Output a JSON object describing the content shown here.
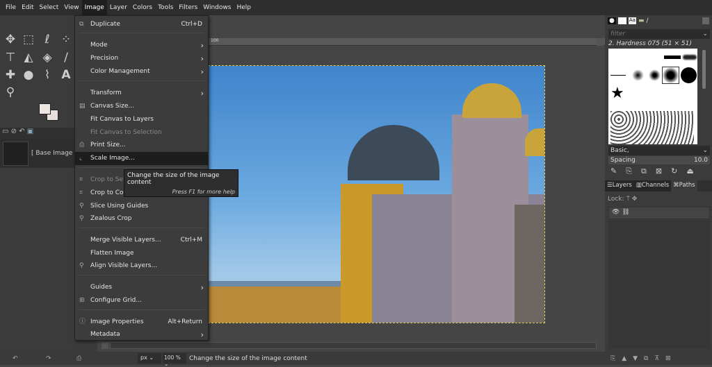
{
  "menubar": [
    "File",
    "Edit",
    "Select",
    "View",
    "Image",
    "Layer",
    "Colors",
    "Tools",
    "Filters",
    "Windows",
    "Help"
  ],
  "image_menu": {
    "items": [
      {
        "label": "Duplicate",
        "shortcut": "Ctrl+D",
        "icon": "duplicate-icon"
      },
      {
        "label": "Mode",
        "submenu": true
      },
      {
        "label": "Precision",
        "submenu": true
      },
      {
        "label": "Color Management",
        "submenu": true
      },
      {
        "label": "Transform",
        "submenu": true
      },
      {
        "label": "Canvas Size...",
        "icon": "canvas-size-icon"
      },
      {
        "label": "Fit Canvas to Layers"
      },
      {
        "label": "Fit Canvas to Selection",
        "disabled": true
      },
      {
        "label": "Print Size...",
        "icon": "printer-icon"
      },
      {
        "label": "Scale Image...",
        "icon": "scale-icon",
        "selected": true
      },
      {
        "label": "Crop to Selection",
        "disabled": true,
        "icon": "crop-icon"
      },
      {
        "label": "Crop to Content",
        "icon": "crop-icon"
      },
      {
        "label": "Slice Using Guides",
        "icon": "slice-icon"
      },
      {
        "label": "Zealous Crop",
        "icon": "zealous-crop-icon"
      },
      {
        "label": "Merge Visible Layers...",
        "shortcut": "Ctrl+M"
      },
      {
        "label": "Flatten Image"
      },
      {
        "label": "Align Visible Layers...",
        "icon": "align-icon"
      },
      {
        "label": "Guides",
        "submenu": true
      },
      {
        "label": "Configure Grid...",
        "icon": "grid-icon"
      },
      {
        "label": "Image Properties",
        "shortcut": "Alt+Return",
        "icon": "info-icon"
      },
      {
        "label": "Metadata",
        "submenu": true
      }
    ]
  },
  "tooltip": {
    "text": "Change the size of the image content",
    "help": "Press F1 for more help"
  },
  "layers_left": {
    "base_image": "[ Base Image ]"
  },
  "ruler": {
    "label": "100"
  },
  "brushes": {
    "filter_placeholder": "filter",
    "current": "2. Hardness 075 (51 × 51)",
    "preset": "Basic,",
    "spacing_label": "Spacing",
    "spacing_value": "10.0"
  },
  "layers_panel": {
    "tabs": [
      "Layers",
      "Channels",
      "Paths"
    ],
    "lock_label": "Lock:"
  },
  "status": {
    "unit": "px",
    "zoom": "100 %",
    "message": "Change the size of the image content"
  }
}
